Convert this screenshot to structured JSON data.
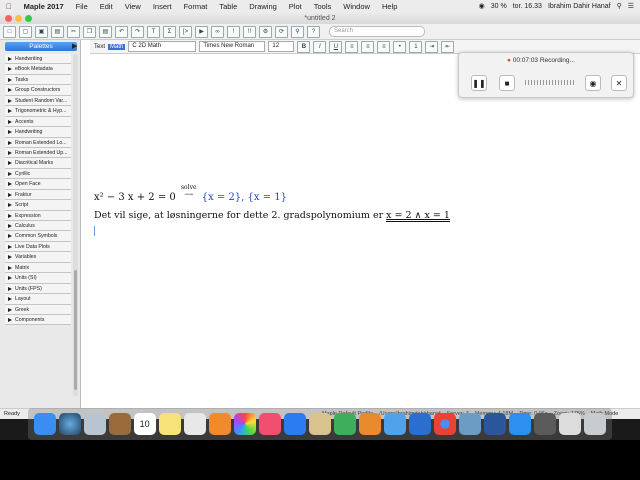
{
  "menubar": {
    "app": "Maple 2017",
    "items": [
      "File",
      "Edit",
      "View",
      "Insert",
      "Format",
      "Table",
      "Drawing",
      "Plot",
      "Tools",
      "Window",
      "Help"
    ],
    "battery": "30 %",
    "clock": "tor. 16.33",
    "user": "Ibrahim Dahir Hanaf"
  },
  "window": {
    "title": "*untitled 2"
  },
  "toolbar": {
    "search_placeholder": "Search"
  },
  "format_bar": {
    "mode_text": "Text",
    "mode_math": "Math",
    "style": "C  2D Math",
    "font": "Times New Roman",
    "size": "12"
  },
  "palettes": {
    "header": "Palettes",
    "items": [
      "Handwriting",
      "eBook Metadata",
      "Tasks",
      "Group Constructors",
      "Student Random Var...",
      "Trigonometric & Hyp...",
      "Accents",
      "Handwriting",
      "Roman Extended Lo...",
      "Roman Extended Up...",
      "Diacritical Marks",
      "Cyrillic",
      "Open Face",
      "Fraktur",
      "Script",
      "Expression",
      "Calculus",
      "Common Symbols",
      "Live Data Plots",
      "Variables",
      "Matrix",
      "Units (SI)",
      "Units (FPS)",
      "Layout",
      "Greek",
      "Components"
    ]
  },
  "document": {
    "math_lhs": "x² − 3 x + 2 = 0",
    "arrow_label": "solve",
    "solution": "{x = 2}, {x = 1}",
    "text": "Det vil sige, at løsningerne for dette 2. gradspolynomium er ",
    "answer": "x = 2 ∧ x = 1"
  },
  "statusbar": {
    "ready": "Ready",
    "profile": "Maple Default Profile",
    "path": "/Users/ibrahimdahirhanaf",
    "server": "Server: 3",
    "memory": "Memory: 4.18M",
    "time": "Time: 0.06s",
    "zoom": "Zoom: 175%",
    "mode": "Math Mode"
  },
  "recording": {
    "label": "00:07:03 Recording..."
  },
  "dock": {
    "calendar_day": "10"
  }
}
